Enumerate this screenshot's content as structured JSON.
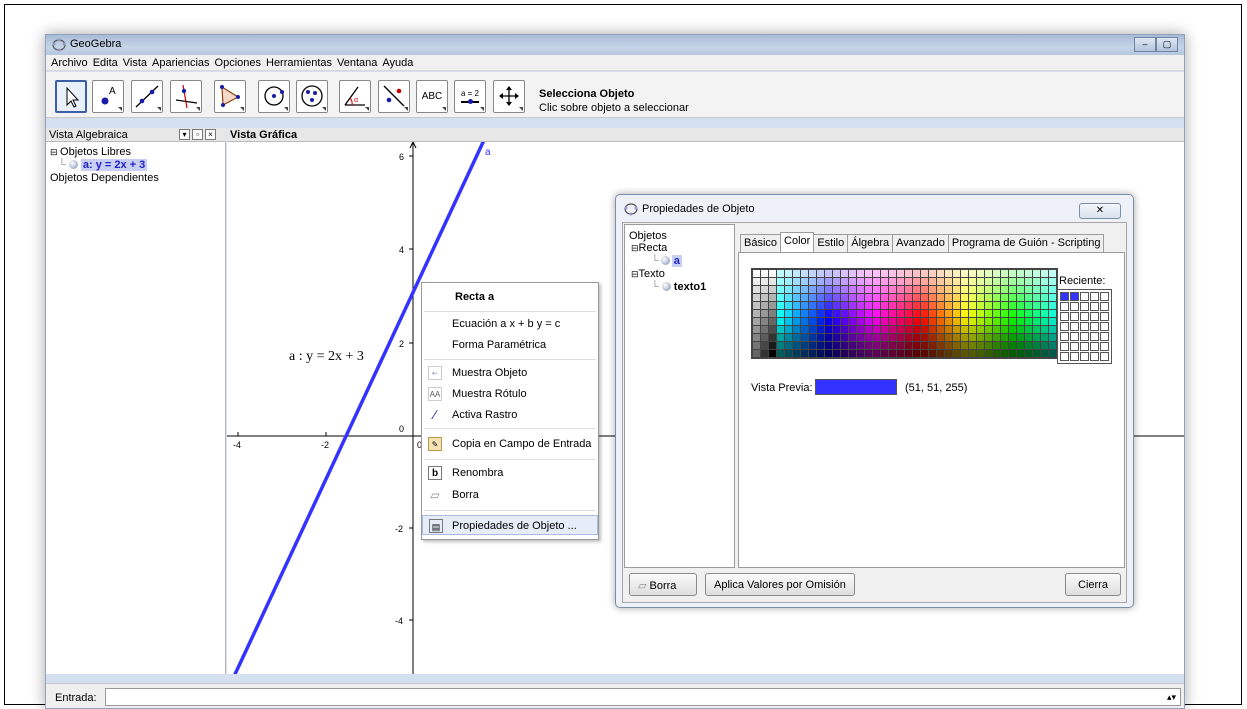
{
  "window": {
    "title": "GeoGebra",
    "minimize": "–",
    "maximize": "▢"
  },
  "menu": [
    "Archivo",
    "Edita",
    "Vista",
    "Apariencias",
    "Opciones",
    "Herramientas",
    "Ventana",
    "Ayuda"
  ],
  "toolbar": {
    "text_tool": "ABC",
    "slider_tool": "a = 2",
    "selected_title": "Selecciona Objeto",
    "selected_desc": "Clic sobre objeto a seleccionar"
  },
  "algebra": {
    "header": "Vista Algebraica",
    "free_objects": "Objetos Libres",
    "item": "a: y = 2x + 3",
    "dependent": "Objetos Dependientes"
  },
  "graphics": {
    "header": "Vista Gráfica",
    "line_label": "a",
    "equation_text": "a : y = 2x + 3",
    "x_ticks": [
      "-4",
      "-2",
      "0"
    ],
    "y_ticks": [
      "6",
      "4",
      "2",
      "0",
      "-2",
      "-4"
    ],
    "line_color": "#3333ff"
  },
  "context_menu": {
    "title": "Recta a",
    "items": [
      {
        "label": "Ecuación a x + b y = c"
      },
      {
        "label": "Forma Paramétrica"
      },
      {
        "label": "Muestra Objeto"
      },
      {
        "label": "Muestra Rótulo"
      },
      {
        "label": "Activa Rastro"
      },
      {
        "label": "Copia en Campo de Entrada"
      },
      {
        "label": "Renombra"
      },
      {
        "label": "Borra"
      },
      {
        "label": "Propiedades de Objeto ..."
      }
    ]
  },
  "dialog": {
    "title": "Propiedades de Objeto",
    "close": "✕",
    "tree": {
      "root": "Objetos",
      "recta": "Recta",
      "a": "a",
      "texto": "Texto",
      "texto1": "texto1"
    },
    "tabs": [
      "Básico",
      "Color",
      "Estilo",
      "Álgebra",
      "Avanzado",
      "Programa de Guión - Scripting"
    ],
    "active_tab": "Color",
    "recent_label": "Reciente:",
    "preview_label": "Vista Previa:",
    "preview_value": "(51, 51, 255)",
    "preview_color": "#3333ff",
    "buttons": {
      "delete": "Borra",
      "defaults": "Aplica Valores por Omisión",
      "close": "Cierra"
    }
  },
  "input": {
    "label": "Entrada:",
    "value": ""
  }
}
